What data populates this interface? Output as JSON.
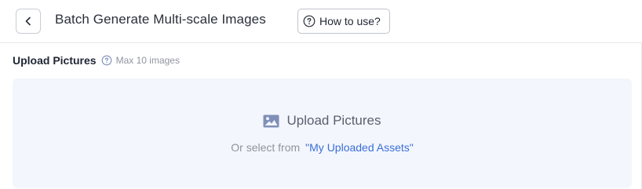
{
  "header": {
    "title": "Batch Generate Multi-scale Images",
    "howto_label": "How to use?"
  },
  "upload": {
    "section_label": "Upload Pictures",
    "max_note": "Max 10 images",
    "dropzone_label": "Upload Pictures",
    "select_from_text": "Or select from",
    "assets_link": "\"My Uploaded Assets\""
  },
  "icons": {
    "back": "chevron-left-icon",
    "help": "question-circle-icon",
    "info": "question-circle-icon",
    "image": "image-icon"
  },
  "colors": {
    "dropzone_bg": "#f3f6fc",
    "link": "#3b6fd8",
    "icon_accent": "#7f8fb8"
  }
}
